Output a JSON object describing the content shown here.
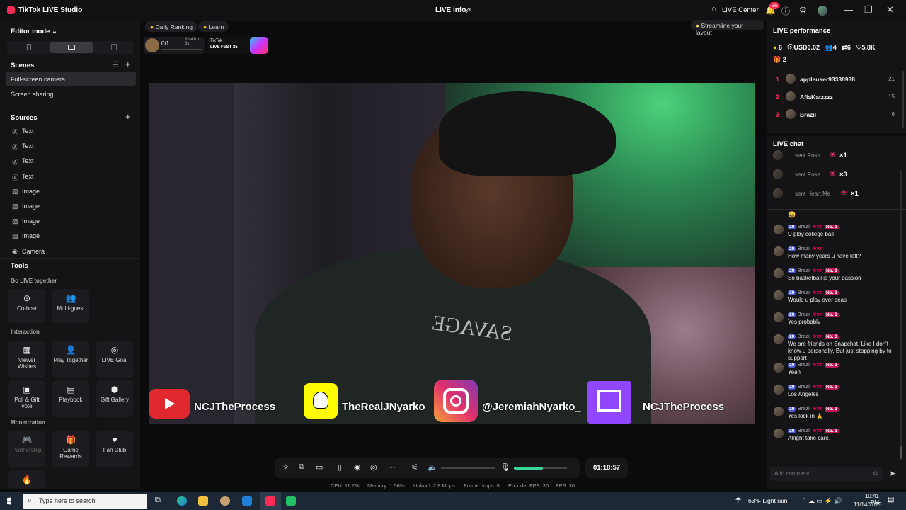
{
  "app": {
    "title": "TikTok LIVE Studio",
    "center_title": "LIVE info",
    "live_center": "LIVE Center",
    "notif_count": "36"
  },
  "left": {
    "editor_mode": "Editor mode",
    "scenes_header": "Scenes",
    "scenes": [
      "Full-screen camera",
      "Screen sharing"
    ],
    "sources_header": "Sources",
    "sources": [
      {
        "icon": "text-icon",
        "label": "Text"
      },
      {
        "icon": "text-icon",
        "label": "Text"
      },
      {
        "icon": "text-icon",
        "label": "Text"
      },
      {
        "icon": "text-icon",
        "label": "Text"
      },
      {
        "icon": "image-icon",
        "label": "Image"
      },
      {
        "icon": "image-icon",
        "label": "Image"
      },
      {
        "icon": "image-icon",
        "label": "Image"
      },
      {
        "icon": "image-icon",
        "label": "Image"
      },
      {
        "icon": "camera-icon",
        "label": "Camera"
      }
    ],
    "tools_header": "Tools",
    "go_live_together": "Go LIVE together",
    "cohost": "Co-host",
    "multiguest": "Multi-guest",
    "interaction": "Interaction",
    "viewer_wishes": "Viewer Wishes",
    "play_together": "Play Together",
    "live_goal": "LIVE Goal",
    "poll_gift": "Poll & Gift vote",
    "playbook": "Playbook",
    "gift_gallery": "Gift Gallery",
    "monetization": "Monetization",
    "partnership": "Partnership",
    "game_rewards": "Game Rewards",
    "fan_club": "Fan Club"
  },
  "center": {
    "daily_ranking": "Daily Ranking",
    "learn": "Learn",
    "streamline": "Streamline your layout",
    "goal_progress": "0/1",
    "goal_time": "2h 41m 8s",
    "fest_line1": "TikTok",
    "fest_line2": "LIVE FEST 25",
    "overlay": {
      "youtube": "NCJTheProcess",
      "snapchat": "TheRealJNyarko",
      "instagram": "@JeremiahNyarko_",
      "twitch": "NCJTheProcess"
    },
    "shirt_text": "SAVAGE",
    "timer": "01:18:57",
    "stats": {
      "cpu": "CPU: 11.7%",
      "memory": "Memory: 1.56%",
      "upload": "Upload: 2.8 Mbps",
      "frame_drops": "Frame drops: 0",
      "encoder": "Encoder FPS: 30",
      "fps": "FPS: 30"
    },
    "volume_level": 0.55
  },
  "right": {
    "perf_header": "LIVE performance",
    "perf": {
      "gifters": "6",
      "usd": "USD0.02",
      "viewers": "4",
      "shares": "6",
      "likes": "5.8K",
      "gifts": "2"
    },
    "ranking": [
      {
        "rank": "1",
        "name": "appleuser93338938",
        "score": "21"
      },
      {
        "rank": "2",
        "name": "AfiaKatzzzz",
        "score": "15"
      },
      {
        "rank": "3",
        "name": "Brazil",
        "score": "6"
      }
    ],
    "chat_header": "LIVE chat",
    "gifts": [
      {
        "text": "sent Rose",
        "count": "×1"
      },
      {
        "text": "sent Rose",
        "count": "×3"
      },
      {
        "text": "sent Heart Me",
        "count": "×1"
      }
    ],
    "messages": [
      {
        "level": "20",
        "user": "Brazil",
        "no": "No. 3",
        "text": "U play college ball"
      },
      {
        "level": "20",
        "user": "Brazil",
        "no": "",
        "text": "How many years u have left?"
      },
      {
        "level": "20",
        "user": "Brazil",
        "no": "No. 3",
        "text": "So basketball is your passion"
      },
      {
        "level": "20",
        "user": "Brazil",
        "no": "No. 3",
        "text": "Would u play over seas"
      },
      {
        "level": "20",
        "user": "Brazil",
        "no": "No. 3",
        "text": "Yes probably"
      },
      {
        "level": "20",
        "user": "Brazil",
        "no": "No. 3",
        "text": "We are friends on Snapchat. Like I don't know u personally. But just stopping by to support"
      },
      {
        "level": "20",
        "user": "Brazil",
        "no": "No. 3",
        "text": "Yeah"
      },
      {
        "level": "20",
        "user": "Brazil",
        "no": "No. 3",
        "text": "Los Angeles"
      },
      {
        "level": "20",
        "user": "Brazil",
        "no": "No. 3",
        "text": "Yes lock in 🙏"
      },
      {
        "level": "20",
        "user": "Brazil",
        "no": "No. 3",
        "text": "Alright take care."
      }
    ],
    "comment_placeholder": "Add comment"
  },
  "taskbar": {
    "search": "Type here to search",
    "weather": "63°F  Light rain",
    "time": "10:41 PM",
    "date": "11/14/2025"
  }
}
